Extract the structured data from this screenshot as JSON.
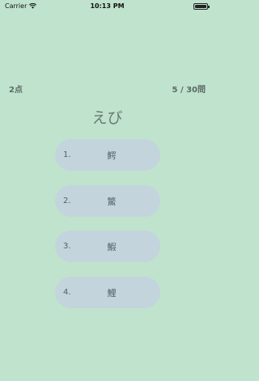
{
  "status": {
    "carrier": "Carrier",
    "time": "10:13 PM"
  },
  "quiz": {
    "score": "2点",
    "progress": "5 / 30問",
    "question": "えび",
    "answers": [
      {
        "num": "1.",
        "text": "鰐"
      },
      {
        "num": "2.",
        "text": "鰵"
      },
      {
        "num": "3.",
        "text": "鰕"
      },
      {
        "num": "4.",
        "text": "鯉"
      }
    ]
  }
}
